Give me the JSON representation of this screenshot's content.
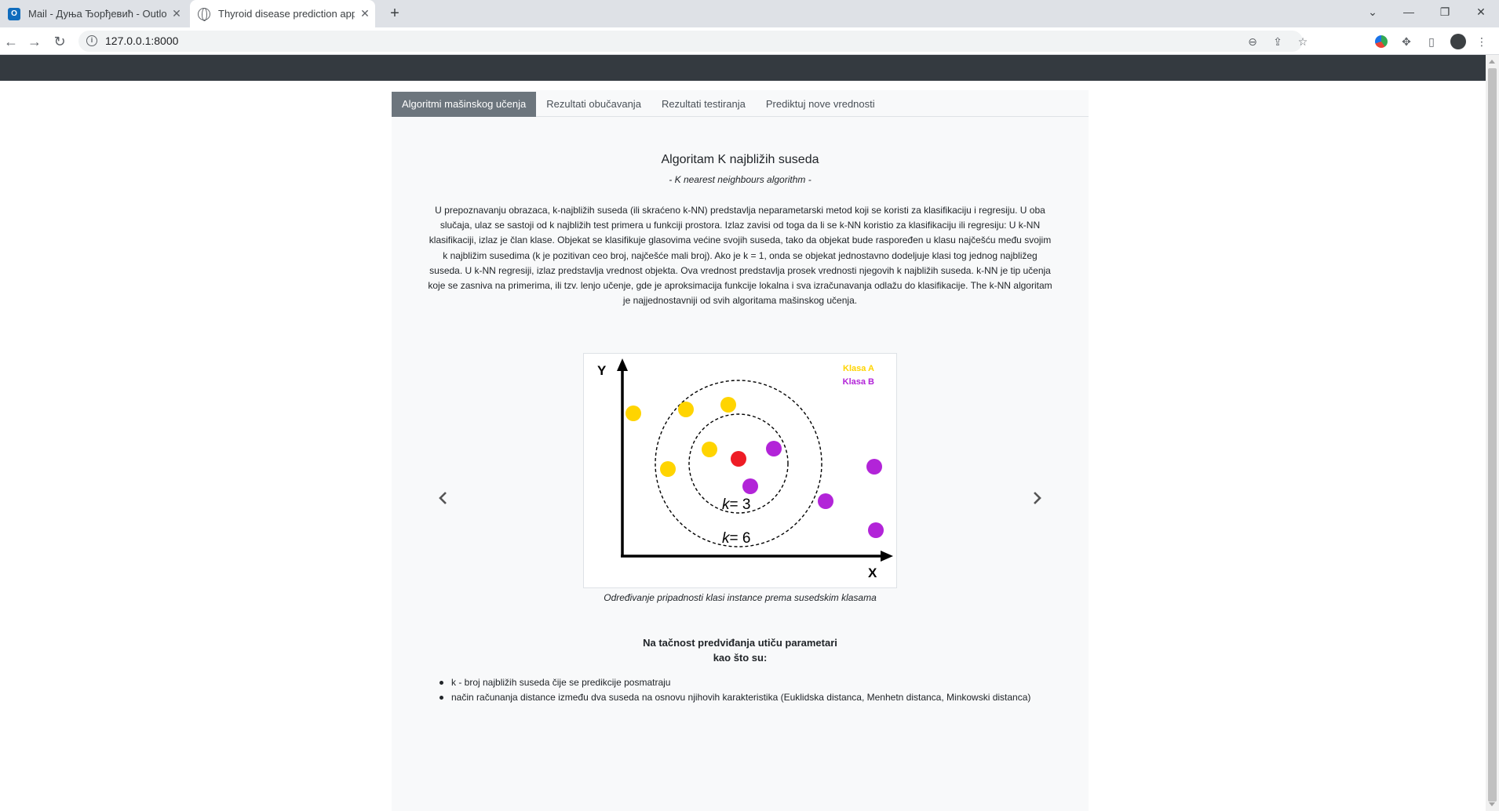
{
  "browser": {
    "tabs": [
      {
        "title": "Mail - Дуња Ђорђевић - Outloo",
        "favicon": "outlook-icon",
        "active": false
      },
      {
        "title": "Thyroid disease prediction app",
        "favicon": "globe-icon",
        "active": true
      }
    ],
    "url": "127.0.0.1:8000"
  },
  "page": {
    "tabs": [
      {
        "label": "Algoritmi mašinskog učenja",
        "active": true
      },
      {
        "label": "Rezultati obučavanja",
        "active": false
      },
      {
        "label": "Rezultati testiranja",
        "active": false
      },
      {
        "label": "Prediktuj nove vrednosti",
        "active": false
      }
    ],
    "heading": "Algoritam K najbližih suseda",
    "subheading": "- K nearest neighbours algorithm -",
    "paragraph": "U prepoznavanju obrazaca, k-najbližih suseda (ili skraćeno k-NN) predstavlja neparametarski metod koji se koristi za klasifikaciju i regresiju. U oba slučaja, ulaz se sastoji od k najbližih test primera u funkciji prostora. Izlaz zavisi od toga da li se k-NN koristio za klasifikaciju ili regresiju: U k-NN klasifikaciji, izlaz je član klase. Objekat se klasifikuje glasovima većine svojih suseda, tako da objekat bude raspoređen u klasu najčešću među svojim k najbližim susedima (k je pozitivan ceo broj, najčešće mali broj). Ako je k = 1, onda se objekat jednostavno dodeljuje klasi tog jednog najbližeg suseda. U k-NN regresiji, izlaz predstavlja vrednost objekta. Ova vrednost predstavlja prosek vrednosti njegovih k najbližih suseda. k-NN je tip učenja koje se zasniva na primerima, ili tzv. lenjo učenje, gde je aproksimacija funkcije lokalna i sva izračunavanja odlažu do klasifikacije. The k-NN algoritam je najjednostavniji od svih algoritama mašinskog učenja.",
    "figure": {
      "y_label": "Y",
      "x_label": "X",
      "legend": [
        {
          "label": "Klasa A",
          "color": "#ffd400"
        },
        {
          "label": "Klasa B",
          "color": "#b224d8"
        }
      ],
      "query_color": "#ee1c25",
      "circles": [
        {
          "k": "k",
          "value": "= 3"
        },
        {
          "k": "k",
          "value": "= 6"
        }
      ]
    },
    "caption": "Određivanje pripadnosti klasi instance prema susedskim klasama",
    "params_title_line1": "Na tačnost predviđanja utiču parametari",
    "params_title_line2": "kao što su:",
    "params": [
      "k - broj najbližih suseda čije se predikcije posmatraju",
      "način računanja distance između dva suseda na osnovu njihovih karakteristika (Euklidska distanca, Menhetn distanca, Minkowski distanca)"
    ]
  }
}
